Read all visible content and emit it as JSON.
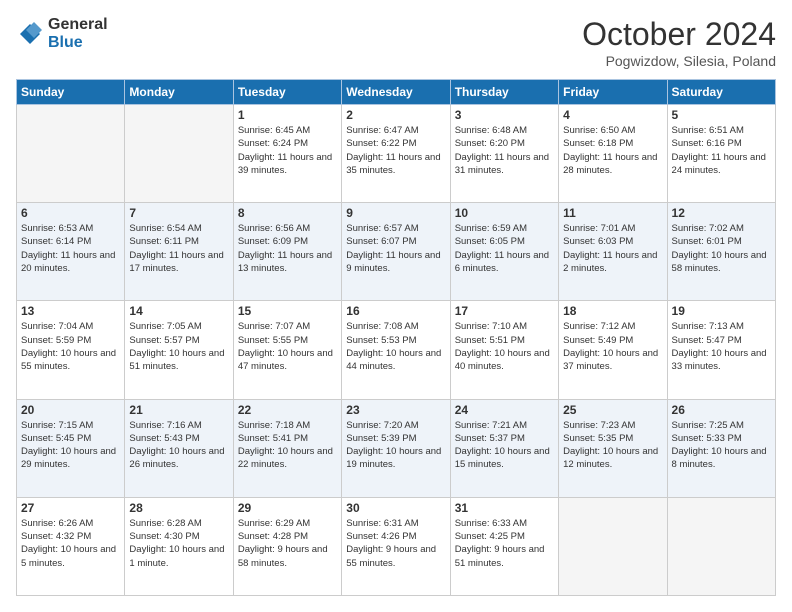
{
  "header": {
    "logo": {
      "general": "General",
      "blue": "Blue"
    },
    "title": "October 2024",
    "subtitle": "Pogwizdow, Silesia, Poland"
  },
  "days_of_week": [
    "Sunday",
    "Monday",
    "Tuesday",
    "Wednesday",
    "Thursday",
    "Friday",
    "Saturday"
  ],
  "weeks": [
    [
      {
        "day": "",
        "empty": true
      },
      {
        "day": "",
        "empty": true
      },
      {
        "day": "1",
        "sunrise": "6:45 AM",
        "sunset": "6:24 PM",
        "daylight": "11 hours and 39 minutes."
      },
      {
        "day": "2",
        "sunrise": "6:47 AM",
        "sunset": "6:22 PM",
        "daylight": "11 hours and 35 minutes."
      },
      {
        "day": "3",
        "sunrise": "6:48 AM",
        "sunset": "6:20 PM",
        "daylight": "11 hours and 31 minutes."
      },
      {
        "day": "4",
        "sunrise": "6:50 AM",
        "sunset": "6:18 PM",
        "daylight": "11 hours and 28 minutes."
      },
      {
        "day": "5",
        "sunrise": "6:51 AM",
        "sunset": "6:16 PM",
        "daylight": "11 hours and 24 minutes."
      }
    ],
    [
      {
        "day": "6",
        "sunrise": "6:53 AM",
        "sunset": "6:14 PM",
        "daylight": "11 hours and 20 minutes."
      },
      {
        "day": "7",
        "sunrise": "6:54 AM",
        "sunset": "6:11 PM",
        "daylight": "11 hours and 17 minutes."
      },
      {
        "day": "8",
        "sunrise": "6:56 AM",
        "sunset": "6:09 PM",
        "daylight": "11 hours and 13 minutes."
      },
      {
        "day": "9",
        "sunrise": "6:57 AM",
        "sunset": "6:07 PM",
        "daylight": "11 hours and 9 minutes."
      },
      {
        "day": "10",
        "sunrise": "6:59 AM",
        "sunset": "6:05 PM",
        "daylight": "11 hours and 6 minutes."
      },
      {
        "day": "11",
        "sunrise": "7:01 AM",
        "sunset": "6:03 PM",
        "daylight": "11 hours and 2 minutes."
      },
      {
        "day": "12",
        "sunrise": "7:02 AM",
        "sunset": "6:01 PM",
        "daylight": "10 hours and 58 minutes."
      }
    ],
    [
      {
        "day": "13",
        "sunrise": "7:04 AM",
        "sunset": "5:59 PM",
        "daylight": "10 hours and 55 minutes."
      },
      {
        "day": "14",
        "sunrise": "7:05 AM",
        "sunset": "5:57 PM",
        "daylight": "10 hours and 51 minutes."
      },
      {
        "day": "15",
        "sunrise": "7:07 AM",
        "sunset": "5:55 PM",
        "daylight": "10 hours and 47 minutes."
      },
      {
        "day": "16",
        "sunrise": "7:08 AM",
        "sunset": "5:53 PM",
        "daylight": "10 hours and 44 minutes."
      },
      {
        "day": "17",
        "sunrise": "7:10 AM",
        "sunset": "5:51 PM",
        "daylight": "10 hours and 40 minutes."
      },
      {
        "day": "18",
        "sunrise": "7:12 AM",
        "sunset": "5:49 PM",
        "daylight": "10 hours and 37 minutes."
      },
      {
        "day": "19",
        "sunrise": "7:13 AM",
        "sunset": "5:47 PM",
        "daylight": "10 hours and 33 minutes."
      }
    ],
    [
      {
        "day": "20",
        "sunrise": "7:15 AM",
        "sunset": "5:45 PM",
        "daylight": "10 hours and 29 minutes."
      },
      {
        "day": "21",
        "sunrise": "7:16 AM",
        "sunset": "5:43 PM",
        "daylight": "10 hours and 26 minutes."
      },
      {
        "day": "22",
        "sunrise": "7:18 AM",
        "sunset": "5:41 PM",
        "daylight": "10 hours and 22 minutes."
      },
      {
        "day": "23",
        "sunrise": "7:20 AM",
        "sunset": "5:39 PM",
        "daylight": "10 hours and 19 minutes."
      },
      {
        "day": "24",
        "sunrise": "7:21 AM",
        "sunset": "5:37 PM",
        "daylight": "10 hours and 15 minutes."
      },
      {
        "day": "25",
        "sunrise": "7:23 AM",
        "sunset": "5:35 PM",
        "daylight": "10 hours and 12 minutes."
      },
      {
        "day": "26",
        "sunrise": "7:25 AM",
        "sunset": "5:33 PM",
        "daylight": "10 hours and 8 minutes."
      }
    ],
    [
      {
        "day": "27",
        "sunrise": "6:26 AM",
        "sunset": "4:32 PM",
        "daylight": "10 hours and 5 minutes."
      },
      {
        "day": "28",
        "sunrise": "6:28 AM",
        "sunset": "4:30 PM",
        "daylight": "10 hours and 1 minute."
      },
      {
        "day": "29",
        "sunrise": "6:29 AM",
        "sunset": "4:28 PM",
        "daylight": "9 hours and 58 minutes."
      },
      {
        "day": "30",
        "sunrise": "6:31 AM",
        "sunset": "4:26 PM",
        "daylight": "9 hours and 55 minutes."
      },
      {
        "day": "31",
        "sunrise": "6:33 AM",
        "sunset": "4:25 PM",
        "daylight": "9 hours and 51 minutes."
      },
      {
        "day": "",
        "empty": true
      },
      {
        "day": "",
        "empty": true
      }
    ]
  ],
  "labels": {
    "sunrise": "Sunrise:",
    "sunset": "Sunset:",
    "daylight": "Daylight:"
  }
}
